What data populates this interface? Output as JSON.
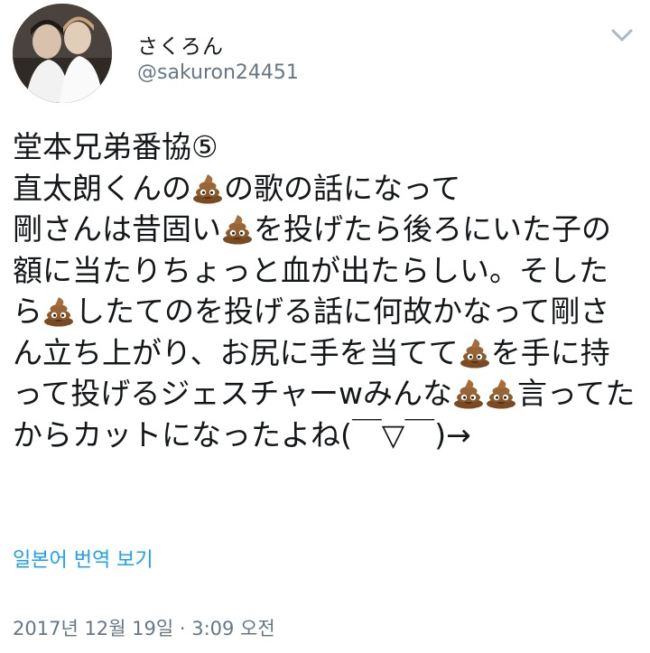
{
  "user": {
    "display_name": "さくろん",
    "handle": "@sakuron24451"
  },
  "tweet": {
    "segments": [
      "堂本兄弟番協⑤\n直太朗くんの",
      "の歌の話になって\n剛さんは昔固い",
      "を投げたら後ろにいた子の額に当たりちょっと血が出たらしい。そしたら",
      "したてのを投げる話に何故かなって剛さん立ち上がり、お尻に手を当てて",
      "を手に持って投げるジェスチャーwみんな",
      "",
      "言ってたからカットになったよね(￣▽￣)→"
    ],
    "emoji_icon": "pile-of-poo-icon"
  },
  "translate_label": "일본어 번역 보기",
  "timestamp": "2017년 12월 19일 · 3:09 오전",
  "colors": {
    "text": "#14171a",
    "secondary": "#657786",
    "link": "#1da1f2",
    "poo": "#8b5a2b"
  }
}
